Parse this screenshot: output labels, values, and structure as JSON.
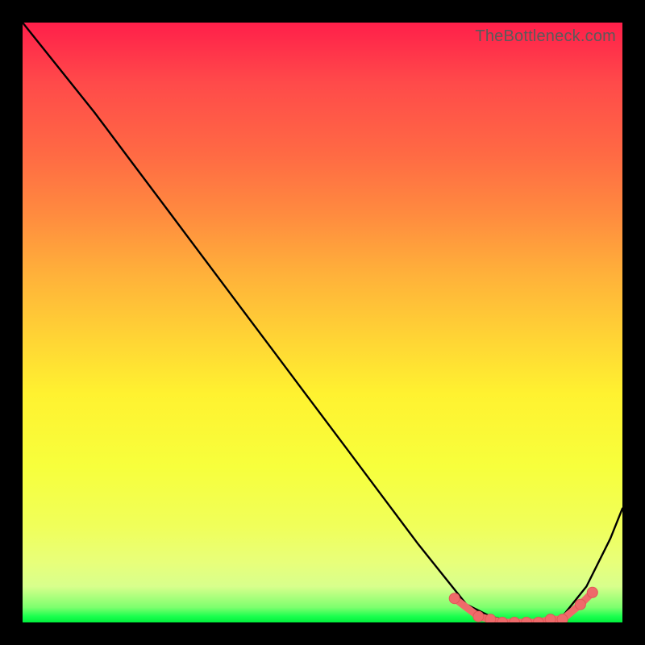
{
  "watermark": "TheBottleneck.com",
  "colors": {
    "line": "#000000",
    "marker": "#ef6a6a",
    "marker_stroke": "#e15757",
    "bg_black": "#000000"
  },
  "chart_data": {
    "type": "line",
    "title": "",
    "xlabel": "",
    "ylabel": "",
    "xlim": [
      0,
      100
    ],
    "ylim": [
      0,
      100
    ],
    "note": "Values are approximate pixel-read estimates; chart has no visible axis ticks. y≈0 indicates the green 'no bottleneck' band.",
    "series": [
      {
        "name": "curve",
        "x": [
          0,
          4,
          8,
          12,
          18,
          24,
          30,
          36,
          42,
          48,
          54,
          60,
          66,
          70,
          74,
          78,
          82,
          86,
          90,
          94,
          98,
          100
        ],
        "y": [
          100,
          95,
          90,
          85,
          77,
          69,
          61,
          53,
          45,
          37,
          29,
          21,
          13,
          8,
          3,
          1,
          0,
          0,
          1,
          6,
          14,
          19
        ]
      }
    ],
    "markers": {
      "name": "highlighted-points",
      "x": [
        72,
        76,
        78,
        80,
        82,
        84,
        86,
        88,
        90,
        93,
        95
      ],
      "y": [
        4,
        1,
        0.5,
        0,
        0,
        0,
        0,
        0.5,
        0.5,
        3,
        5
      ]
    }
  }
}
